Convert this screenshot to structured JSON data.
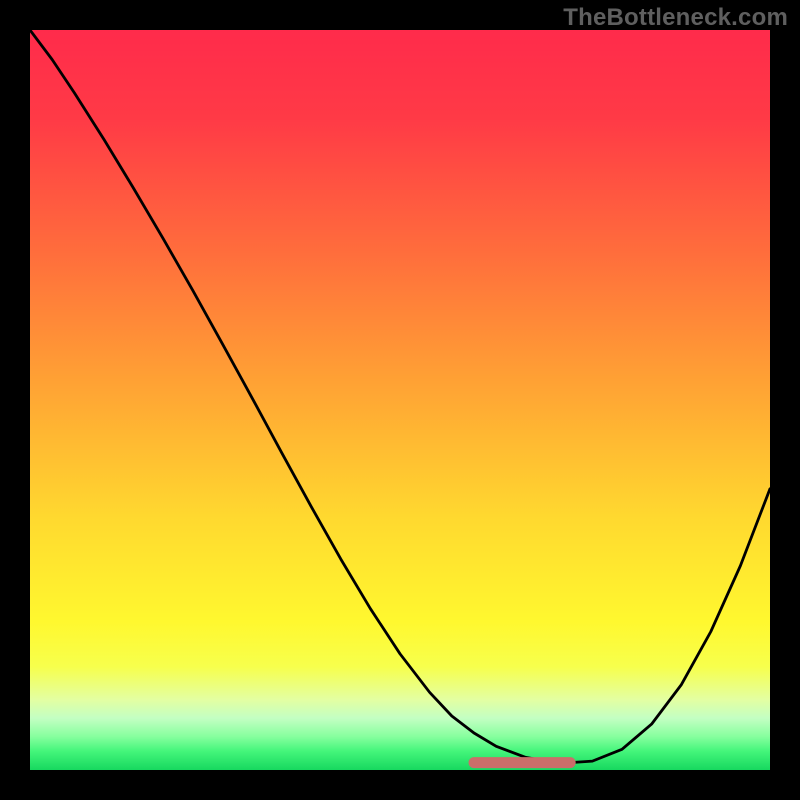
{
  "watermark": "TheBottleneck.com",
  "chart_data": {
    "type": "line",
    "title": "",
    "xlabel": "",
    "ylabel": "",
    "xlim": [
      0,
      100
    ],
    "ylim": [
      0,
      100
    ],
    "background_gradient": {
      "stops": [
        {
          "offset": 0.0,
          "color": "#ff2b4b"
        },
        {
          "offset": 0.12,
          "color": "#ff3a46"
        },
        {
          "offset": 0.3,
          "color": "#ff6d3c"
        },
        {
          "offset": 0.48,
          "color": "#ffa334"
        },
        {
          "offset": 0.66,
          "color": "#ffd92f"
        },
        {
          "offset": 0.8,
          "color": "#fff82f"
        },
        {
          "offset": 0.86,
          "color": "#f7ff4c"
        },
        {
          "offset": 0.905,
          "color": "#e3ffa2"
        },
        {
          "offset": 0.93,
          "color": "#c3ffc3"
        },
        {
          "offset": 0.955,
          "color": "#86ff9e"
        },
        {
          "offset": 0.975,
          "color": "#43f57a"
        },
        {
          "offset": 1.0,
          "color": "#17d85f"
        }
      ]
    },
    "x": [
      0,
      3,
      6,
      10,
      14,
      18,
      22,
      26,
      30,
      34,
      38,
      42,
      46,
      50,
      54,
      57,
      60,
      63,
      67,
      71,
      73,
      76,
      80,
      84,
      88,
      92,
      96,
      100
    ],
    "values": [
      100,
      96,
      91.5,
      85.2,
      78.6,
      71.8,
      64.8,
      57.6,
      50.3,
      42.9,
      35.6,
      28.5,
      21.8,
      15.7,
      10.5,
      7.3,
      5.0,
      3.2,
      1.7,
      1.0,
      1.0,
      1.2,
      2.8,
      6.2,
      11.5,
      18.7,
      27.6,
      38.0
    ],
    "plateau": {
      "x_start": 60,
      "x_end": 73,
      "y": 1.0
    },
    "notes": "Approximate V-shaped bottleneck curve with flat minimum plateau highlighted in salmon; y-axis is inverted visually (0 at bottom), qualitative only (no axis ticks shown)."
  }
}
